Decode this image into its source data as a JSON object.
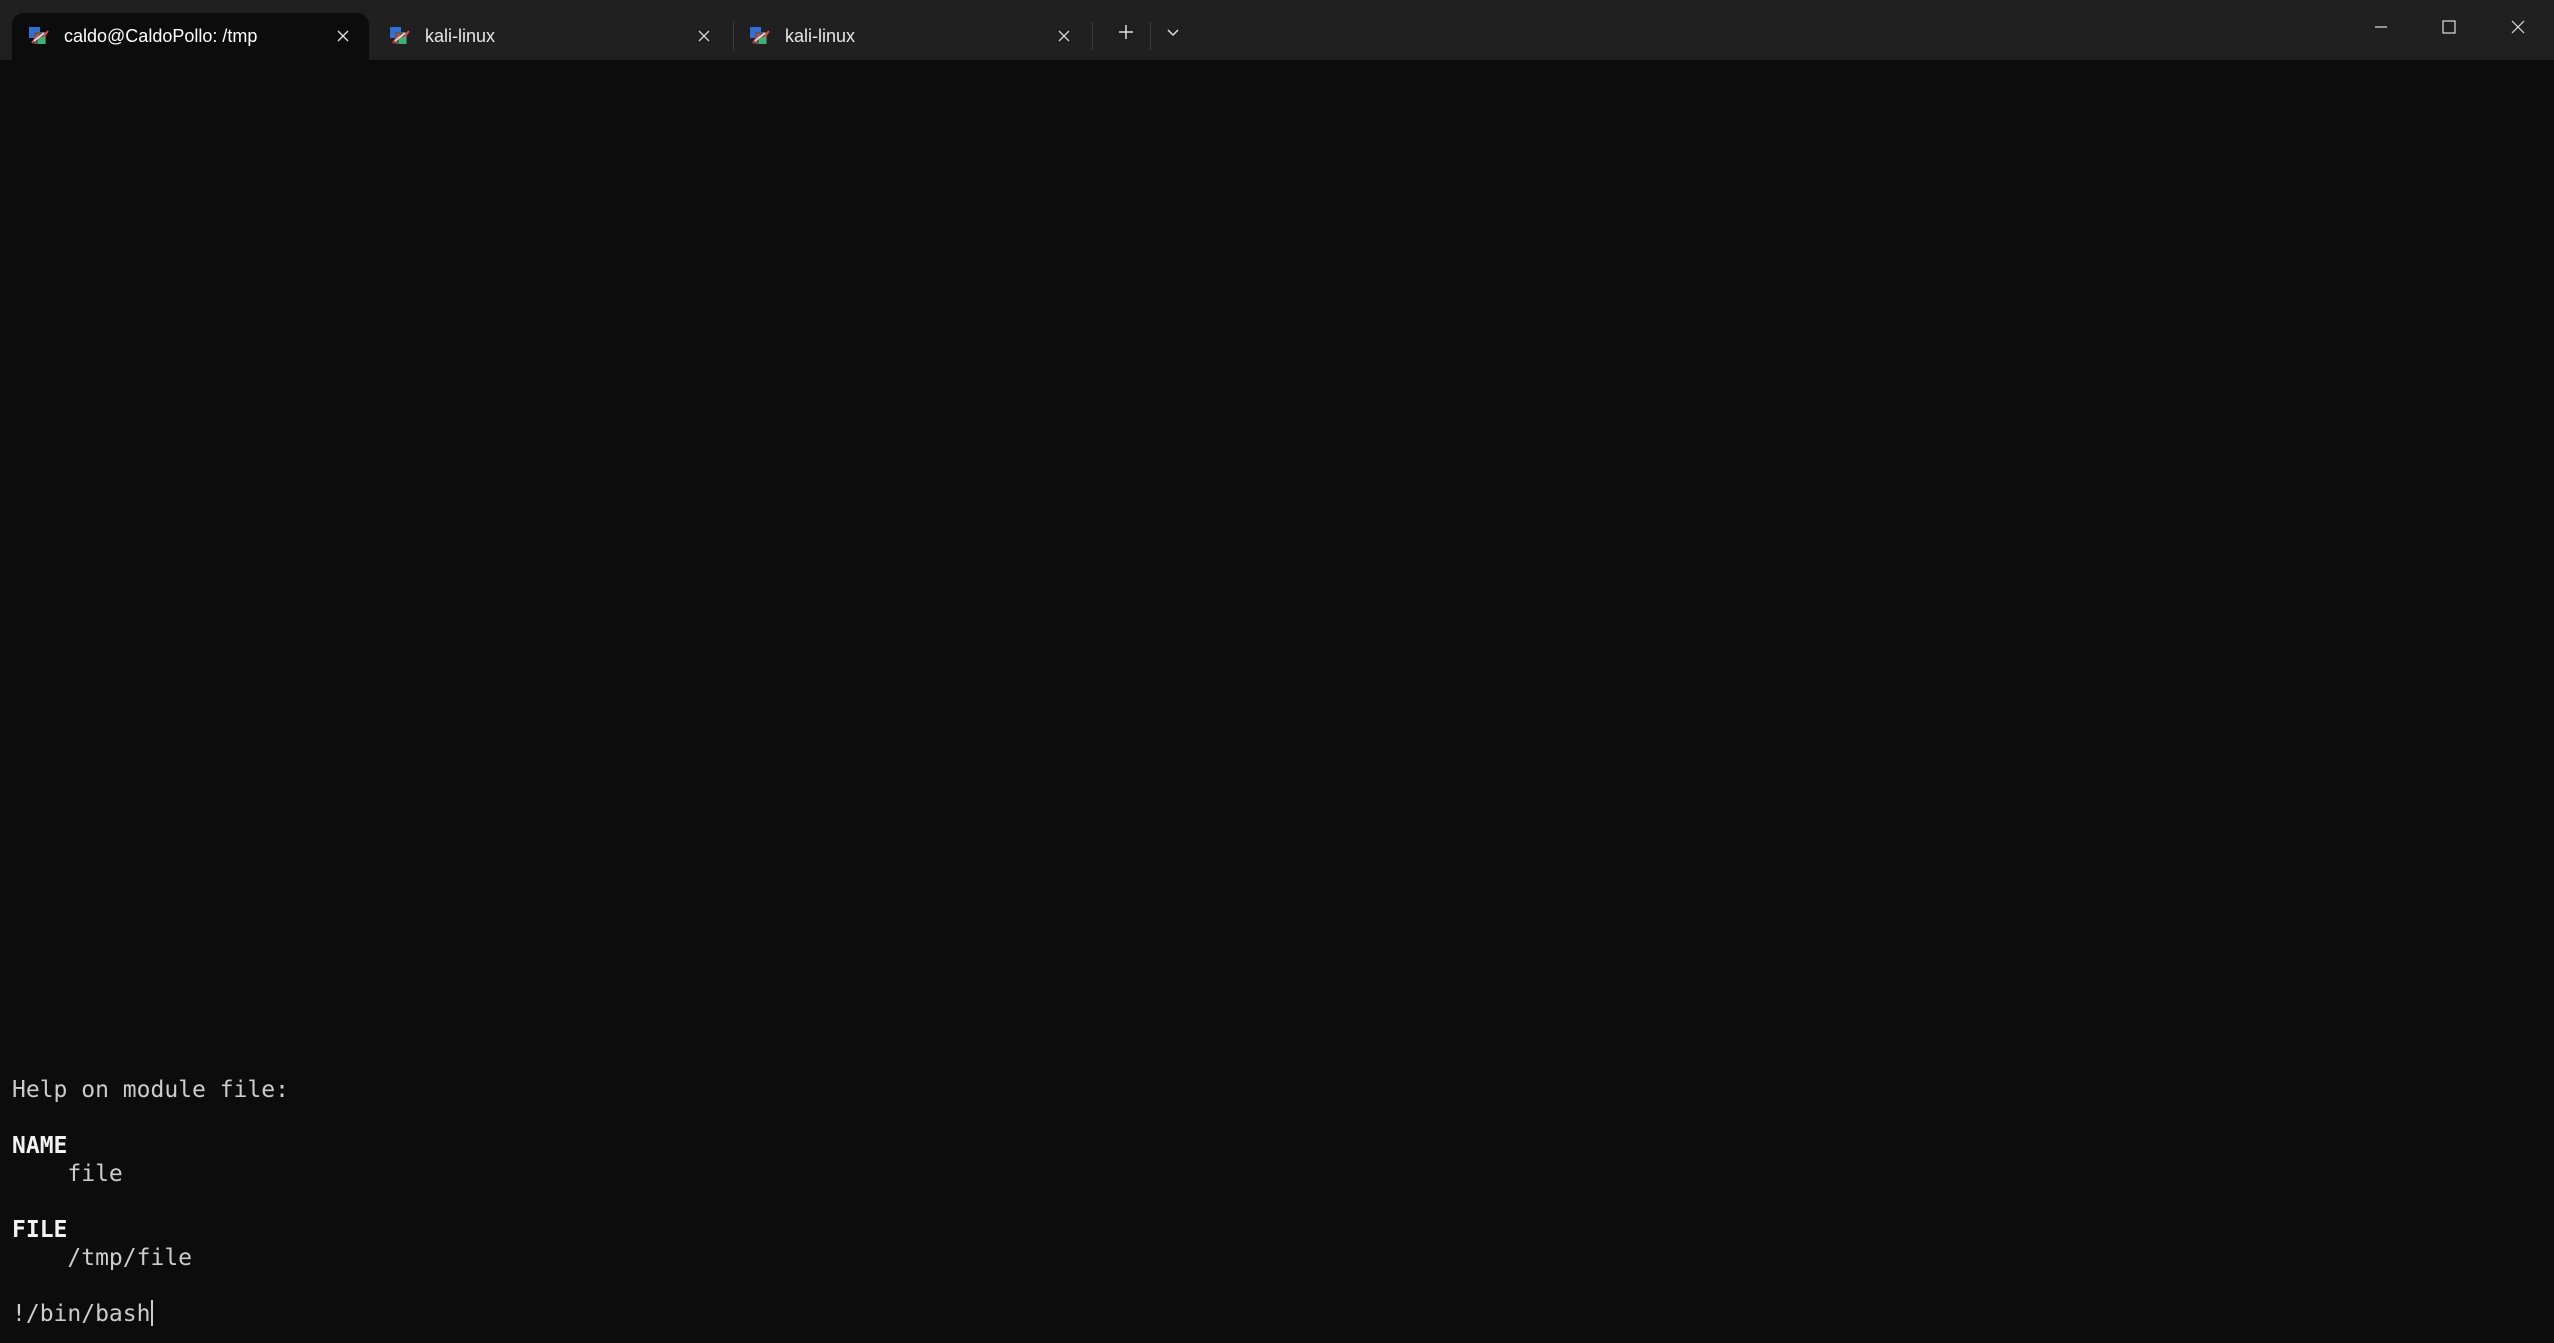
{
  "window": {
    "tabs": [
      {
        "label": "caldo@CaldoPollo: /tmp",
        "active": true,
        "icon": "kali-linux-icon"
      },
      {
        "label": "kali-linux",
        "active": false,
        "icon": "kali-linux-icon"
      },
      {
        "label": "kali-linux",
        "active": false,
        "icon": "kali-linux-icon"
      }
    ],
    "new_tab_icon": "plus-icon",
    "dropdown_icon": "chevron-down-icon",
    "controls": [
      "minimize-icon",
      "maximize-icon",
      "close-icon"
    ]
  },
  "terminal": {
    "lines": [
      {
        "text": "Help on module file:",
        "bold": false
      },
      {
        "text": "",
        "bold": false
      },
      {
        "text": "NAME",
        "bold": true
      },
      {
        "text": "    file",
        "bold": false
      },
      {
        "text": "",
        "bold": false
      },
      {
        "text": "FILE",
        "bold": true
      },
      {
        "text": "    /tmp/file",
        "bold": false
      },
      {
        "text": "",
        "bold": false
      },
      {
        "text": "!/bin/bash",
        "bold": false
      }
    ]
  },
  "colors": {
    "titlebar_bg": "#202020",
    "terminal_bg": "#0c0c0c",
    "text": "#cccccc",
    "bold_text": "#f2f2f2"
  }
}
